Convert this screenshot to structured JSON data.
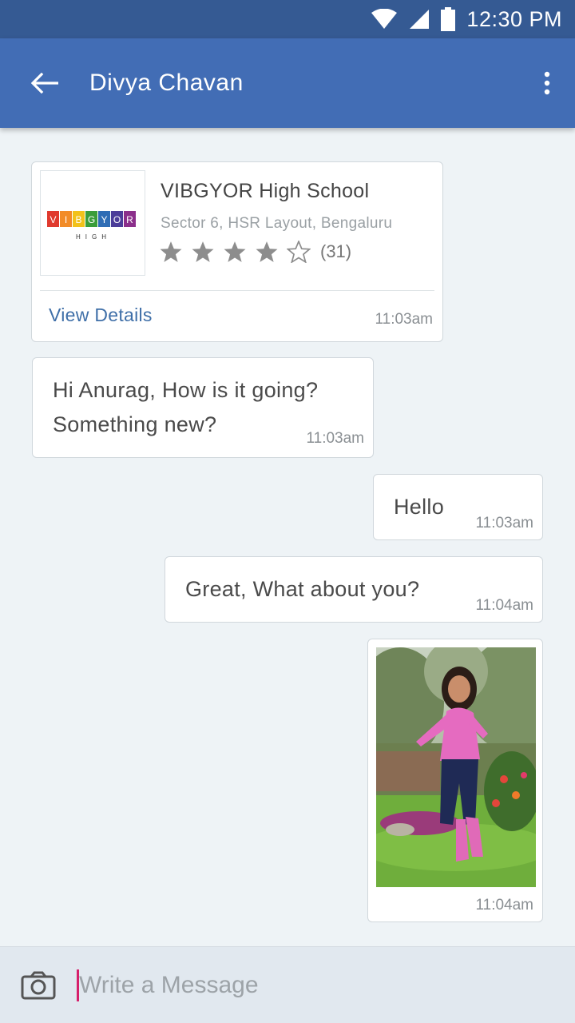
{
  "status_bar": {
    "time": "12:30 PM"
  },
  "header": {
    "title": "Divya Chavan",
    "back_icon": "arrow-back-icon",
    "menu_icon": "more-vert-icon"
  },
  "school_card": {
    "logo_text": "VIBGYOR",
    "logo_subtext": "HIGH",
    "logo_colors": [
      "#e03a2e",
      "#f28c28",
      "#f2c21b",
      "#3a9d3a",
      "#2f6db5",
      "#4b3d99",
      "#8b2f8b"
    ],
    "name": "VIBGYOR High School",
    "address": "Sector 6, HSR Layout, Bengaluru",
    "rating": 4,
    "rating_max": 5,
    "rating_count": "(31)",
    "action_label": "View Details",
    "time": "11:03am"
  },
  "messages": [
    {
      "direction": "incoming",
      "lines": [
        "Hi Anurag, How is it going?",
        "Something new?"
      ],
      "time": "11:03am"
    },
    {
      "direction": "outgoing",
      "text": "Hello",
      "time": "11:03am"
    },
    {
      "direction": "outgoing",
      "text": "Great, What about you?",
      "time": "11:04am"
    },
    {
      "direction": "outgoing",
      "type": "image",
      "time": "11:04am"
    }
  ],
  "composer": {
    "placeholder": "Write a Message",
    "camera_icon": "camera-icon"
  },
  "colors": {
    "status_bar": "#355a93",
    "app_bar": "#426db5",
    "link": "#3f6fa8",
    "caret": "#d6206b"
  }
}
